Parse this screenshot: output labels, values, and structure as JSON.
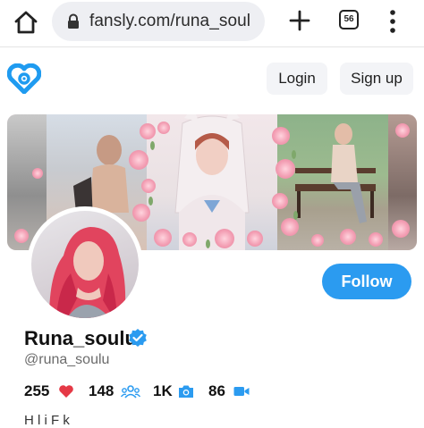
{
  "browser": {
    "url": "fansly.com/runa_soul",
    "tab_count": "56",
    "icons": [
      "home-icon",
      "lock-icon",
      "plus-icon",
      "tabs-icon",
      "more-vert-icon"
    ]
  },
  "header": {
    "logo_icon": "fansly-logo-icon",
    "login_label": "Login",
    "signup_label": "Sign up"
  },
  "profile": {
    "display_name": "Runa_soulu",
    "handle": "@runa_soulu",
    "follow_label": "Follow",
    "verified_icon": "verified-badge-icon",
    "stats": [
      {
        "value": "255",
        "icon": "heart-icon"
      },
      {
        "value": "148",
        "icon": "followers-icon"
      },
      {
        "value": "1K",
        "icon": "camera-icon"
      },
      {
        "value": "86",
        "icon": "video-icon"
      }
    ],
    "bio_partial": "H   l        i  F       k"
  },
  "colors": {
    "accent_blue": "#2b9bf0",
    "heart_red": "#e53946",
    "button_bg": "#f3f4f7",
    "urlbar_bg": "#eeeff3"
  }
}
